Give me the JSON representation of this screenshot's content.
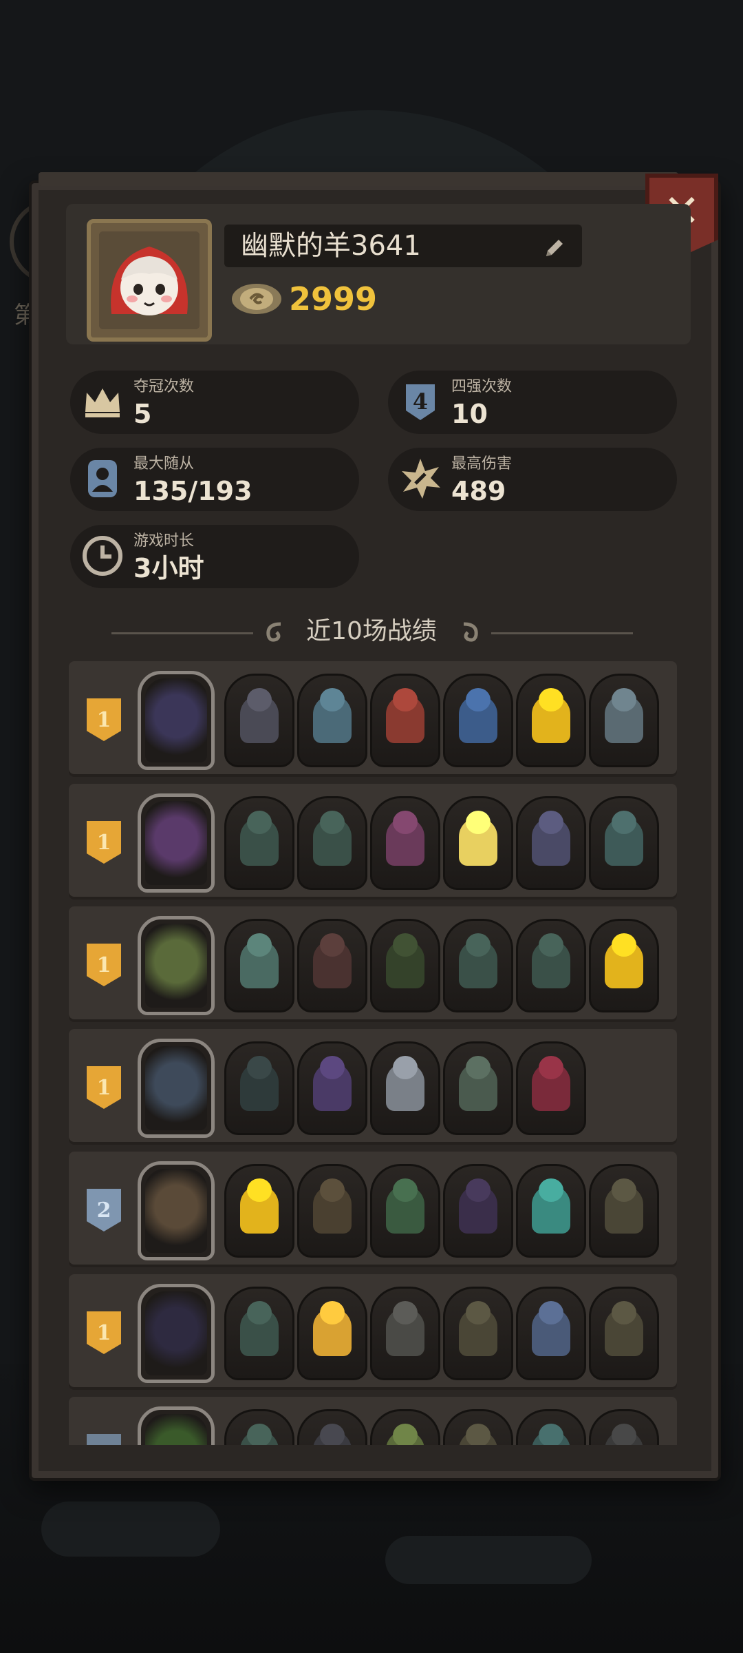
{
  "profile": {
    "nickname": "幽默的羊3641",
    "coins": "2999"
  },
  "stats": [
    {
      "label": "夺冠次数",
      "value": "5",
      "icon": "crown-icon"
    },
    {
      "label": "四强次数",
      "value": "10",
      "icon": "top4-shield-icon"
    },
    {
      "label": "最大随从",
      "value": "135/193",
      "icon": "minion-icon"
    },
    {
      "label": "最高伤害",
      "value": "489",
      "icon": "damage-burst-icon"
    },
    {
      "label": "游戏时长",
      "value": "3小时",
      "icon": "clock-icon"
    }
  ],
  "section": {
    "title": "近10场战绩"
  },
  "close": {
    "label": "✕"
  },
  "background": {
    "left_label": "第"
  },
  "matches": [
    {
      "rank": "1",
      "rank_style": "gold",
      "hero_color": "#3b3658",
      "units": [
        "#4a4a55",
        "#4b6a78",
        "#8a3a30",
        "#3c5c8a",
        "#e2b31c",
        "#5a6a72"
      ]
    },
    {
      "rank": "1",
      "rank_style": "gold",
      "hero_color": "#5a3a6a",
      "units": [
        "#3a5048",
        "#3a5048",
        "#6a3a5a",
        "#e8d060",
        "#4a4a66",
        "#3e5a58"
      ]
    },
    {
      "rank": "1",
      "rank_style": "gold",
      "hero_color": "#5a6a3a",
      "units": [
        "#4a6a62",
        "#4a3230",
        "#34422a",
        "#3a5048",
        "#3a5048",
        "#e2b31c"
      ]
    },
    {
      "rank": "1",
      "rank_style": "gold",
      "hero_color": "#3e4a5a",
      "units": [
        "#2e3a3a",
        "#4a3a66",
        "#7a8088",
        "#4a5a4e",
        "#7a2a3a"
      ]
    },
    {
      "rank": "2",
      "rank_style": "silver",
      "hero_color": "#5a4a38",
      "units": [
        "#e2b31c",
        "#4a4030",
        "#3a5a40",
        "#3a2e4a",
        "#3a8a80",
        "#4a4636"
      ]
    },
    {
      "rank": "1",
      "rank_style": "gold",
      "hero_color": "#2e2a40",
      "units": [
        "#3a5048",
        "#d9a232",
        "#4a4a46",
        "#4a4636",
        "#4a5a78",
        "#4a4636"
      ]
    },
    {
      "rank": "",
      "rank_style": "dark",
      "hero_color": "#3a5a2a",
      "units": [
        "#3a5048",
        "#3a3a40",
        "#5a6a3a",
        "#4a4636",
        "#3a5a58",
        "#3a3a3a"
      ]
    }
  ]
}
